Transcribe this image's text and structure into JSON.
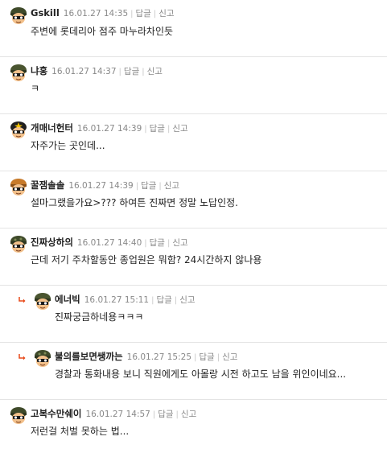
{
  "actions": {
    "reply": "답글",
    "report": "신고"
  },
  "comments": [
    {
      "nick": "Gskill",
      "date": "16.01.27 14:35",
      "text": "주변에 롯데리아 점주 마누라차인듯",
      "avatar": "soldier-avatar-icon"
    },
    {
      "nick": "냐홍",
      "date": "16.01.27 14:37",
      "text": "ㅋ",
      "avatar": "soldier-avatar-icon"
    },
    {
      "nick": "개매너헌터",
      "date": "16.01.27 14:39",
      "text": "자주가는 곳인데...",
      "avatar": "star-helmet-avatar-icon"
    },
    {
      "nick": "꿀잼솔솔",
      "date": "16.01.27 14:39",
      "text": "설마그랬을가요>??? 하여튼 진짜면 정말 노답인정.",
      "avatar": "soldier-avatar-icon"
    },
    {
      "nick": "진짜상하의",
      "date": "16.01.27 14:40",
      "text": "근데 저기 주차할동안 종업원은 뭐함? 24시간하지 않나용",
      "avatar": "soldier-avatar-icon"
    },
    {
      "nick": "에너빅",
      "date": "16.01.27 15:11",
      "text": "진짜궁금하네용ㅋㅋㅋ",
      "avatar": "soldier-avatar-icon",
      "reply": true
    },
    {
      "nick": "불의를보면쌩까는",
      "date": "16.01.27 15:25",
      "text": "경찰과 통화내용 보니 직원에게도 아몰랑 시전 하고도 남을 위인이네요...",
      "avatar": "soldier-avatar-icon",
      "reply": true
    },
    {
      "nick": "고복수만쉐이",
      "date": "16.01.27 14:57",
      "text": "저런걸 처벌 못하는 법...",
      "avatar": "soldier-avatar-icon"
    }
  ]
}
